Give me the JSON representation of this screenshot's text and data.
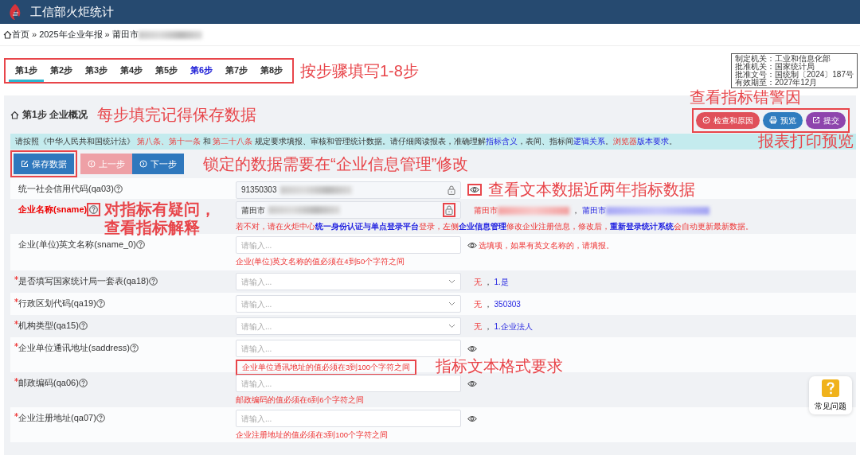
{
  "app": {
    "title": "工信部火炬统计"
  },
  "breadcrumb": [
    {
      "text": "首页",
      "kind": "home"
    },
    {
      "text": "»",
      "kind": "sep"
    },
    {
      "text": "2025年企业年报",
      "kind": "link"
    },
    {
      "text": "»",
      "kind": "sep"
    },
    {
      "text": "莆田市",
      "kind": "link",
      "blurred": true
    }
  ],
  "steps": {
    "marked": true,
    "note": "按步骤填写1-8步",
    "items": [
      {
        "label": "第1步",
        "selected": true,
        "highlighted": false
      },
      {
        "label": "第2步",
        "selected": false,
        "highlighted": false
      },
      {
        "label": "第3步",
        "selected": false,
        "highlighted": false
      },
      {
        "label": "第4步",
        "selected": false,
        "highlighted": false
      },
      {
        "label": "第5步",
        "selected": false,
        "highlighted": false
      },
      {
        "label": "第6步",
        "selected": false,
        "highlighted": true
      },
      {
        "label": "第7步",
        "selected": false,
        "highlighted": false
      },
      {
        "label": "第8步",
        "selected": false,
        "highlighted": false
      }
    ]
  },
  "approval_info": [
    "制定机关：工业和信息化部",
    "批准机关：国家统计局",
    "批准文号：国统制〔2024〕187号",
    "有效期至：2027年12月"
  ],
  "panel": {
    "title": "第1步 企业概况",
    "title_note": "每步填完记得保存数据",
    "actions": {
      "marked": true,
      "note_above": "查看指标错警因",
      "note_below": "报表打印预览",
      "buttons": [
        {
          "label": "检查和原因",
          "kind": "check"
        },
        {
          "label": "预览",
          "kind": "print"
        },
        {
          "label": "提交",
          "kind": "submit"
        }
      ]
    },
    "notice": [
      {
        "text": "请按照《中华人民共和国统计法》 ",
        "kind": "plain"
      },
      {
        "text": "第八条、第十一条",
        "kind": "red"
      },
      {
        "text": " 和 ",
        "kind": "plain"
      },
      {
        "text": "第二十八条",
        "kind": "red"
      },
      {
        "text": " 规定要求填报、审核和管理统计数据。请仔细阅读报表，准确理解",
        "kind": "plain"
      },
      {
        "text": "指标含义",
        "kind": "blue"
      },
      {
        "text": "，表间、指标间",
        "kind": "plain"
      },
      {
        "text": "逻辑关系",
        "kind": "blue"
      },
      {
        "text": "。",
        "kind": "plain"
      },
      {
        "text": "浏览器",
        "kind": "red"
      },
      {
        "text": "版本要求",
        "kind": "blue"
      },
      {
        "text": "。",
        "kind": "plain"
      }
    ],
    "nav": {
      "note": "锁定的数据需要在“企业信息管理”修改",
      "buttons": [
        {
          "label": "保存数据",
          "kind": "save",
          "disabled": false,
          "marked": true
        },
        {
          "label": "上一步",
          "kind": "prev",
          "disabled": true
        },
        {
          "label": "下一步",
          "kind": "next",
          "disabled": false
        }
      ]
    },
    "fields": [
      {
        "label": "统一社会信用代码(qa03)",
        "required": false,
        "emphasized": false,
        "help_marked": false,
        "control": {
          "kind": "text",
          "value": "91350303",
          "blurred": true,
          "locked": true,
          "lock_marked": false
        },
        "eye": true,
        "eye_marked": true,
        "note": "查看文本数据近两年指标数据"
      },
      {
        "label": "企业名称(sname)",
        "required": false,
        "emphasized": true,
        "help_marked": true,
        "note": "对指标有疑问，查看指标解释",
        "control": {
          "kind": "text",
          "value": "莆田市",
          "blurred": true,
          "locked": true,
          "lock_marked": true
        },
        "eye": false,
        "side": [
          {
            "text": "莆田市",
            "kind": "red",
            "blurred": true
          },
          {
            "text": "，",
            "kind": "plain",
            "blurred": false
          },
          {
            "text": "莆田市",
            "kind": "blue",
            "blurred": true
          }
        ],
        "message": [
          {
            "text": "若不对，请在火炬中心",
            "kind": "red"
          },
          {
            "text": "统一身份认证与单点登录平台",
            "kind": "blue"
          },
          {
            "text": "登录，左侧",
            "kind": "red"
          },
          {
            "text": "企业信息管理",
            "kind": "blue"
          },
          {
            "text": "修改企业注册信息，修改后，",
            "kind": "red"
          },
          {
            "text": "重新登录统计系统",
            "kind": "blue"
          },
          {
            "text": "会自动更新最新数据。",
            "kind": "red"
          }
        ]
      },
      {
        "label": "企业(单位)英文名称(sname_0)",
        "required": false,
        "emphasized": false,
        "help_marked": false,
        "control": {
          "kind": "text",
          "placeholder": "请输入..."
        },
        "eye": true,
        "eye_marked": false,
        "hint": "选填项，如果有英文名称的，请填报。",
        "error": "企业(单位)英文名称的值必须在4到50个字符之间",
        "error_marked": false
      },
      {
        "label": "是否填写国家统计局一套表(qa18)",
        "required": true,
        "emphasized": false,
        "help_marked": false,
        "control": {
          "kind": "select",
          "placeholder": "请输入..."
        },
        "eye": false,
        "side": [
          {
            "text": "无",
            "kind": "red",
            "blurred": false
          },
          {
            "text": "，",
            "kind": "plain",
            "blurred": false
          },
          {
            "text": "1.是",
            "kind": "blue",
            "blurred": false
          }
        ]
      },
      {
        "label": "行政区划代码(qa19)",
        "required": true,
        "emphasized": false,
        "help_marked": false,
        "control": {
          "kind": "select",
          "placeholder": "请输入..."
        },
        "eye": false,
        "side": [
          {
            "text": "无",
            "kind": "red",
            "blurred": false
          },
          {
            "text": "，",
            "kind": "plain",
            "blurred": false
          },
          {
            "text": "350303",
            "kind": "blue",
            "blurred": false
          }
        ]
      },
      {
        "label": "机构类型(qa15)",
        "required": true,
        "emphasized": false,
        "help_marked": false,
        "control": {
          "kind": "select",
          "placeholder": "请输入..."
        },
        "eye": false,
        "side": [
          {
            "text": "无",
            "kind": "red",
            "blurred": false
          },
          {
            "text": "，",
            "kind": "plain",
            "blurred": false
          },
          {
            "text": "1.企业法人",
            "kind": "blue",
            "blurred": false
          }
        ]
      },
      {
        "label": "企业单位通讯地址(saddress)",
        "required": true,
        "emphasized": false,
        "help_marked": false,
        "control": {
          "kind": "text",
          "placeholder": "请输入..."
        },
        "eye": true,
        "eye_marked": false,
        "error": "企业单位通讯地址的值必须在3到100个字符之间",
        "error_marked": true,
        "error_note": "指标文本格式要求"
      },
      {
        "label": "邮政编码(qa06)",
        "required": true,
        "emphasized": false,
        "help_marked": false,
        "control": {
          "kind": "text",
          "placeholder": "请输入..."
        },
        "eye": true,
        "eye_marked": false,
        "error": "邮政编码的值必须在6到6个字符之间",
        "error_marked": false
      },
      {
        "label": "企业注册地址(qa07)",
        "required": true,
        "emphasized": false,
        "help_marked": false,
        "control": {
          "kind": "text",
          "placeholder": "请输入..."
        },
        "eye": true,
        "eye_marked": false,
        "error": "企业注册地址的值必须在3到100个字符之间",
        "error_marked": false
      }
    ]
  },
  "help_button": {
    "label": "常见问题"
  }
}
